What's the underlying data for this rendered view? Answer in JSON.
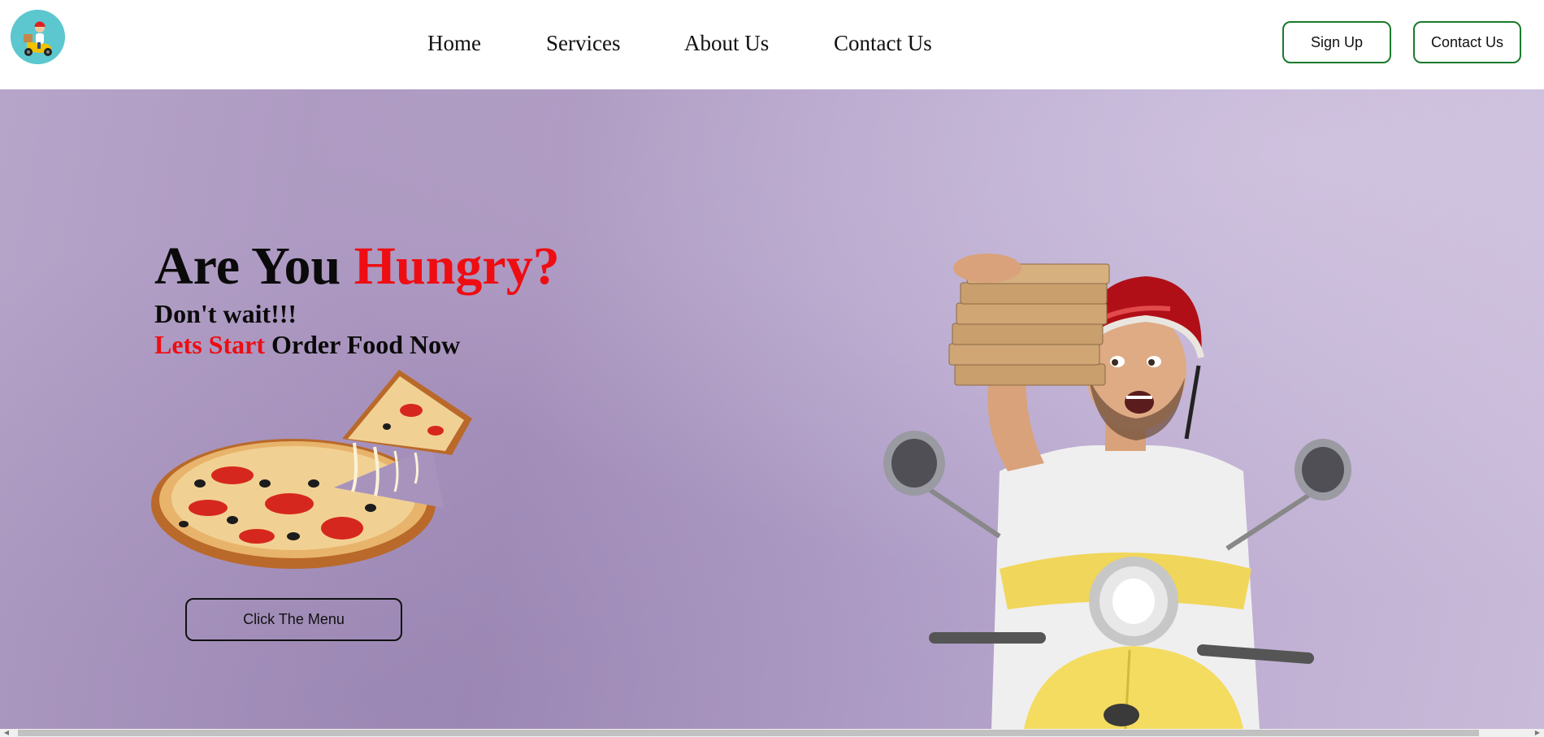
{
  "header": {
    "logo_icon": "delivery-scooter-logo-icon",
    "nav": [
      {
        "label": "Home"
      },
      {
        "label": "Services"
      },
      {
        "label": "About Us"
      },
      {
        "label": "Contact Us"
      }
    ],
    "signup_label": "Sign Up",
    "contact_label": "Contact Us"
  },
  "hero": {
    "headline_part1": "Are You ",
    "headline_part2": "Hungry?",
    "subline1": "Don't wait!!!",
    "subline2_red": "Lets Start",
    "subline2_rest": " Order Food Now",
    "cta_label": "Click The Menu",
    "pizza_image": "pizza-image",
    "rider_image": "delivery-rider-image"
  },
  "colors": {
    "accent_red": "#ee0d12",
    "button_border_green": "#1a7a2a",
    "hero_background": "#b6a4c9",
    "logo_background": "#5cc7cf"
  }
}
